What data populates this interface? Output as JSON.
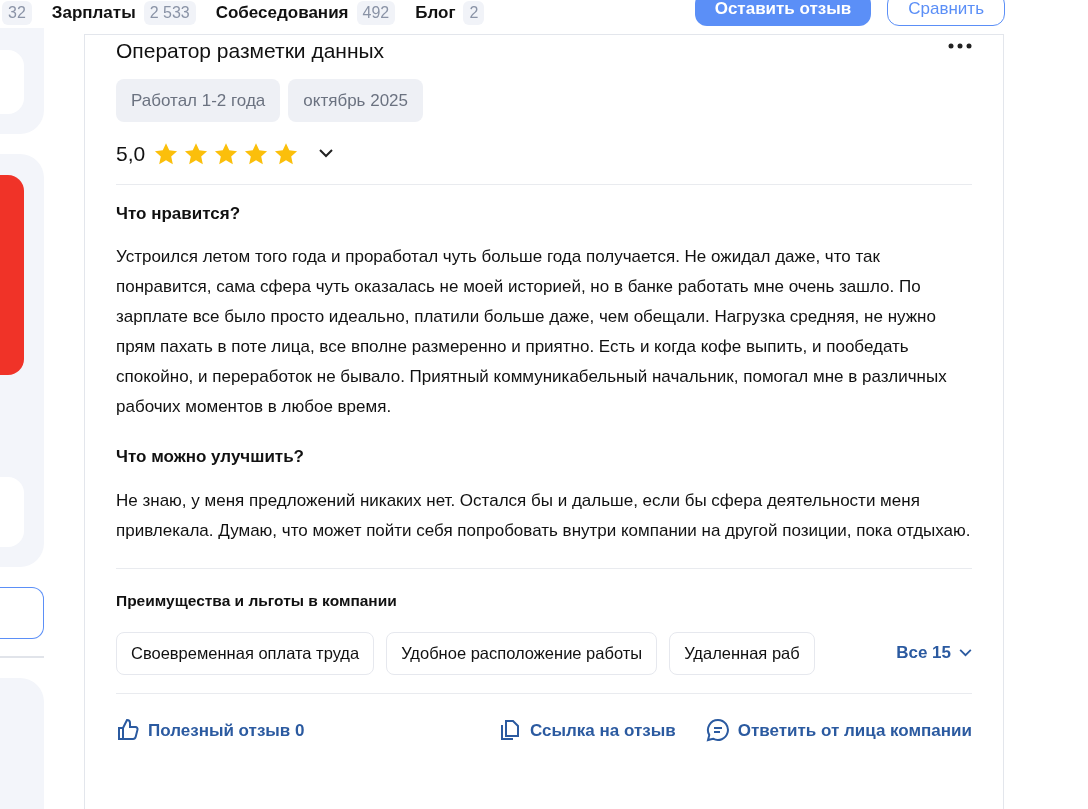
{
  "nav": [
    {
      "count": "32"
    },
    {
      "label": "Зарплаты",
      "count": "2 533"
    },
    {
      "label": "Собеседования",
      "count": "492"
    },
    {
      "label": "Блог",
      "count": "2"
    }
  ],
  "actions": [
    {
      "label": "Оставить отзыв",
      "kind": "primary"
    },
    {
      "label": "Сравнить",
      "kind": "outline"
    }
  ],
  "review": {
    "position": "Оператор разметки данных",
    "tags": [
      "Работал 1-2 года",
      "октябрь 2025"
    ],
    "rating": "5,0",
    "stars": 5,
    "sections": [
      {
        "heading": "Что нравится?",
        "text": "Устроился летом того года и проработал чуть больше года получается. Не ожидал даже, что так понравится, сама сфера чуть оказалась не моей историей, но в банке работать мне очень зашло. По зарплате все было просто идеально, платили больше даже, чем обещали. Нагрузка средняя, не нужно прям пахать в поте лица, все вполне размеренно и приятно. Есть и когда кофе выпить, и пообедать спокойно, и переработок не бывало. Приятный коммуникабельный начальник, помогал мне в различных рабочих моментов в любое время."
      },
      {
        "heading": "Что можно улучшить?",
        "text": "Не знаю, у меня предложений никаких нет. Остался бы и дальше, если бы сфера деятельности меня привлекала. Думаю, что может пойти себя попробовать внутри компании на другой позиции, пока отдыхаю."
      }
    ],
    "benefits": {
      "heading": "Преимущества и льготы в компании",
      "items": [
        "Своевременная оплата труда",
        "Удобное расположение работы",
        "Удаленная раб"
      ],
      "more": "Все 15"
    },
    "footer": [
      {
        "kind": "like",
        "label": "Полезный отзыв 0"
      },
      {
        "kind": "link",
        "label": "Ссылка на отзыв"
      },
      {
        "kind": "reply",
        "label": "Ответить от лица компании"
      }
    ]
  }
}
